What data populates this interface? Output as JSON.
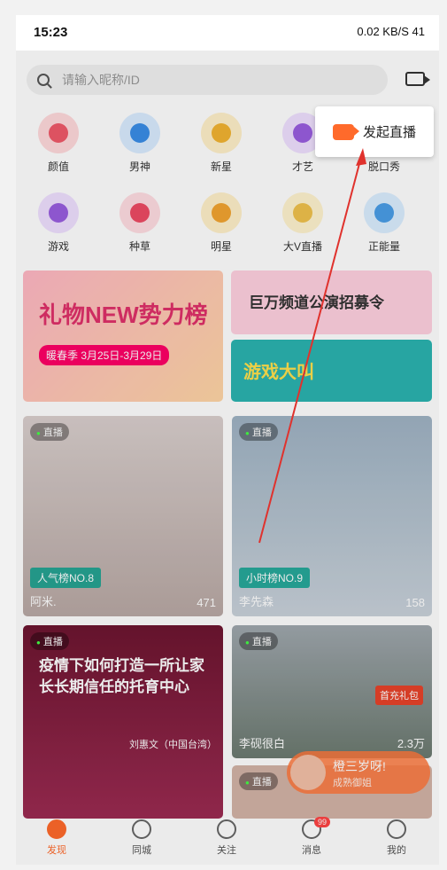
{
  "status_bar": {
    "time": "15:23",
    "right": "0.02 KB/S  41"
  },
  "search": {
    "placeholder": "请输入昵称/ID"
  },
  "categories_row1": [
    "颜值",
    "男神",
    "新星",
    "才艺",
    "脱口秀"
  ],
  "categories_row2": [
    "游戏",
    "种草",
    "明星",
    "大V直播",
    "正能量"
  ],
  "banners": {
    "left_title": "礼物NEW势力榜",
    "left_sub": "暖春季 3月25日-3月29日",
    "right_top": "巨万频道公演招募令",
    "right_bottom": "游戏大叫"
  },
  "cards": [
    {
      "badge": "直播",
      "rank": "人气榜NO.8",
      "name": "阿米.",
      "count": "471"
    },
    {
      "badge": "直播",
      "rank": "小时榜NO.9",
      "name": "李先森",
      "count": "158"
    },
    {
      "badge": "直播",
      "title": "疫情下如何打造一所让家长长期信任的托育中心",
      "speaker": "刘惠文（中国台湾）"
    },
    {
      "badge": "直播",
      "name": "李砚很白",
      "count": "2.3万",
      "gift": "首充礼包"
    },
    {
      "badge": "直播",
      "name": "橙三岁呀!",
      "sub": "成熟御姐"
    }
  ],
  "popup": {
    "label": "发起直播"
  },
  "tabs": [
    "发现",
    "同城",
    "关注",
    "消息",
    "我的"
  ],
  "messages_count": "99"
}
